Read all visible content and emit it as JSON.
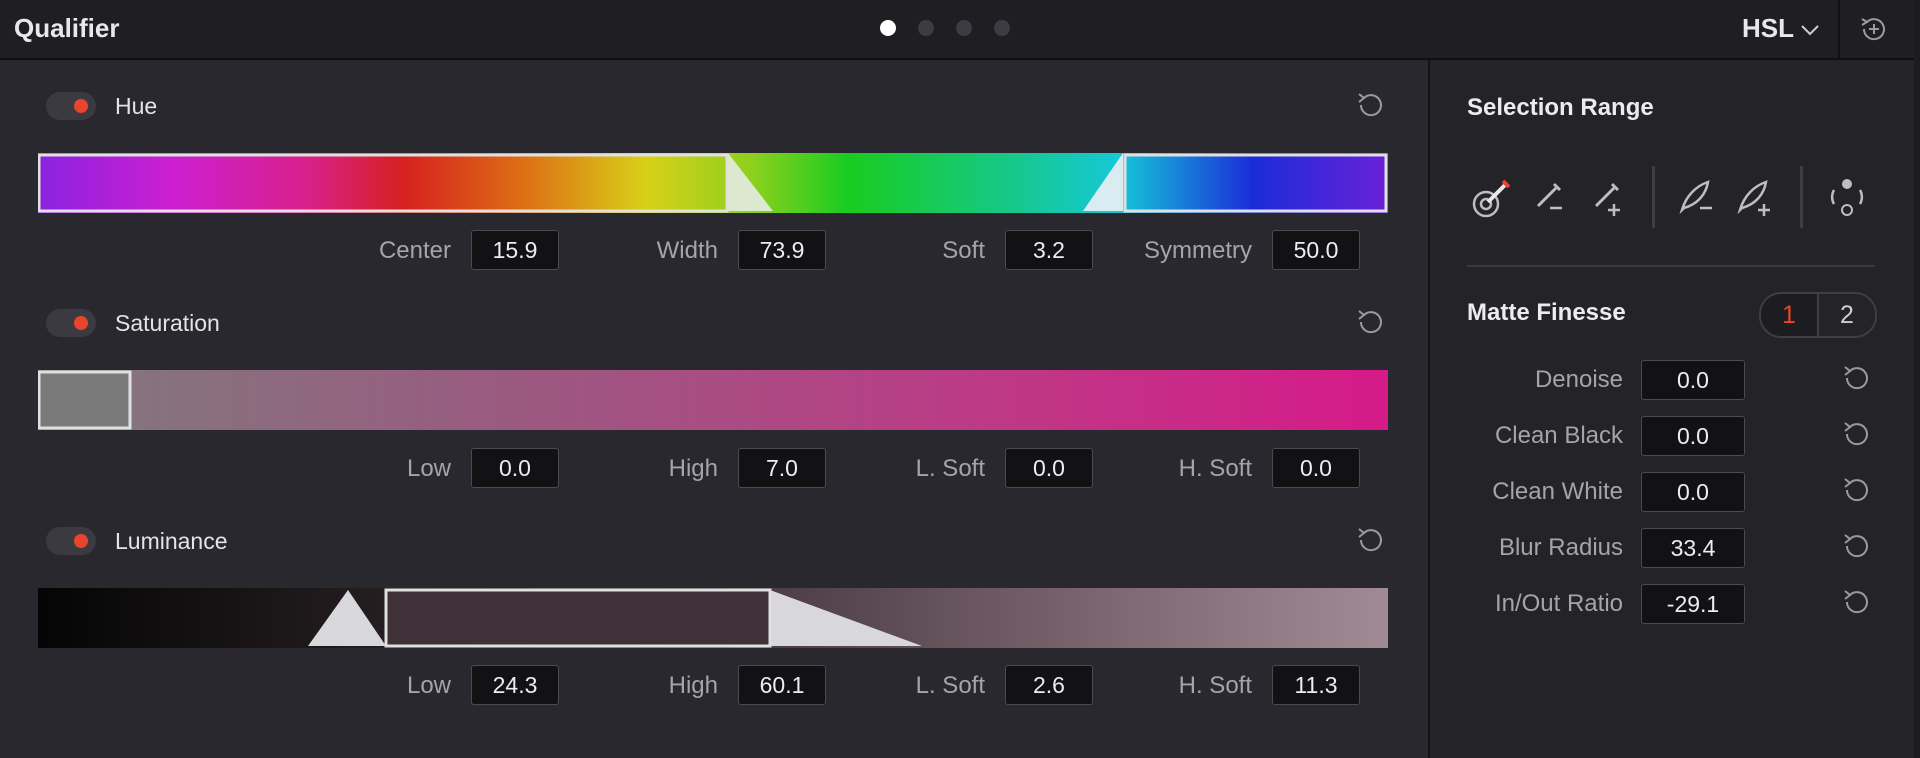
{
  "header": {
    "title": "Qualifier",
    "mode": "HSL",
    "page_dots": 4,
    "active_page": 1
  },
  "hue": {
    "label": "Hue",
    "enabled": true,
    "params": [
      {
        "label": "Center",
        "value": "15.9"
      },
      {
        "label": "Width",
        "value": "73.9"
      },
      {
        "label": "Soft",
        "value": "3.2"
      },
      {
        "label": "Symmetry",
        "value": "50.0"
      }
    ]
  },
  "saturation": {
    "label": "Saturation",
    "enabled": true,
    "params": [
      {
        "label": "Low",
        "value": "0.0"
      },
      {
        "label": "High",
        "value": "7.0"
      },
      {
        "label": "L. Soft",
        "value": "0.0"
      },
      {
        "label": "H. Soft",
        "value": "0.0"
      }
    ]
  },
  "luminance": {
    "label": "Luminance",
    "enabled": true,
    "params": [
      {
        "label": "Low",
        "value": "24.3"
      },
      {
        "label": "High",
        "value": "60.1"
      },
      {
        "label": "L. Soft",
        "value": "2.6"
      },
      {
        "label": "H. Soft",
        "value": "11.3"
      }
    ]
  },
  "selection_range": {
    "title": "Selection Range",
    "tools": [
      "picker-icon",
      "picker-minus-icon",
      "picker-plus-icon",
      "feather-minus-icon",
      "feather-plus-icon",
      "invert-icon"
    ]
  },
  "matte_finesse": {
    "title": "Matte Finesse",
    "tabs": [
      "1",
      "2"
    ],
    "active_tab": "1",
    "rows": [
      {
        "label": "Denoise",
        "value": "0.0"
      },
      {
        "label": "Clean Black",
        "value": "0.0"
      },
      {
        "label": "Clean White",
        "value": "0.0"
      },
      {
        "label": "Blur Radius",
        "value": "33.4"
      },
      {
        "label": "In/Out Ratio",
        "value": "-29.1"
      }
    ]
  },
  "colors": {
    "accent_red": "#e8452c",
    "background": "#28282e",
    "field": "#121214"
  }
}
